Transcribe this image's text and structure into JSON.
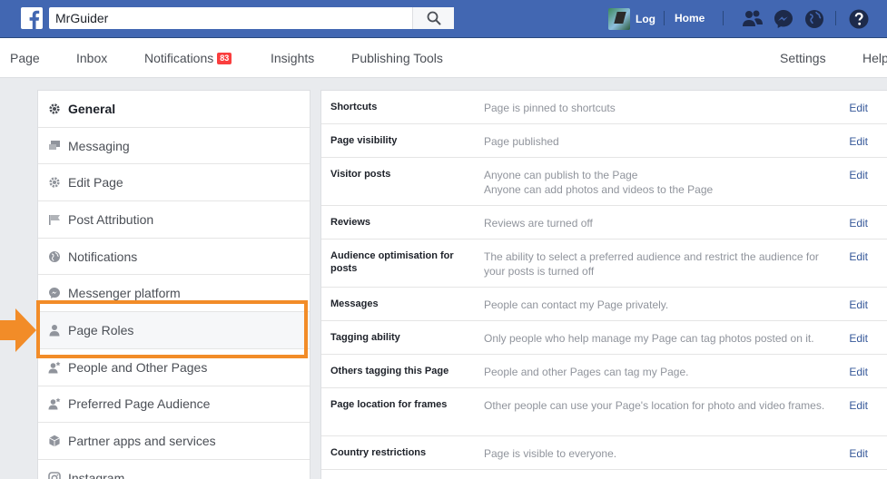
{
  "topbar": {
    "search_value": "MrGuider",
    "user_name": "Log",
    "home_label": "Home"
  },
  "tabs": {
    "page": "Page",
    "inbox": "Inbox",
    "notifications": "Notifications",
    "notifications_count": "83",
    "insights": "Insights",
    "publishing_tools": "Publishing Tools",
    "settings": "Settings",
    "help": "Help"
  },
  "sidebar": {
    "items": [
      {
        "label": "General",
        "icon": "gear-icon"
      },
      {
        "label": "Messaging",
        "icon": "chat-icon"
      },
      {
        "label": "Edit Page",
        "icon": "gear-icon"
      },
      {
        "label": "Post Attribution",
        "icon": "flag-icon"
      },
      {
        "label": "Notifications",
        "icon": "globe-icon"
      },
      {
        "label": "Messenger platform",
        "icon": "messenger-icon"
      },
      {
        "label": "Page Roles",
        "icon": "person-icon"
      },
      {
        "label": "People and Other Pages",
        "icon": "person-star-icon"
      },
      {
        "label": "Preferred Page Audience",
        "icon": "person-star-icon"
      },
      {
        "label": "Partner apps and services",
        "icon": "cube-icon"
      },
      {
        "label": "Instagram",
        "icon": "instagram-icon"
      }
    ]
  },
  "settings": {
    "edit_label": "Edit",
    "rows": [
      {
        "label": "Shortcuts",
        "value": "Page is pinned to shortcuts"
      },
      {
        "label": "Page visibility",
        "value": "Page published"
      },
      {
        "label": "Visitor posts",
        "value": "Anyone can publish to the Page",
        "value2": "Anyone can add photos and videos to the Page"
      },
      {
        "label": "Reviews",
        "value": "Reviews are turned off"
      },
      {
        "label": "Audience optimisation for posts",
        "value": "The ability to select a preferred audience and restrict the audience for your posts is turned off"
      },
      {
        "label": "Messages",
        "value": "People can contact my Page privately."
      },
      {
        "label": "Tagging ability",
        "value": "Only people who help manage my Page can tag photos posted on it."
      },
      {
        "label": "Others tagging this Page",
        "value": "People and other Pages can tag my Page."
      },
      {
        "label": "Page location for frames",
        "value": "Other people can use your Page's location for photo and video frames."
      },
      {
        "label": "Country restrictions",
        "value": "Page is visible to everyone."
      }
    ]
  },
  "colors": {
    "brand_blue": "#4267b2",
    "link_blue": "#365899",
    "badge_red": "#fa3e3e",
    "highlight_orange": "#f28c28"
  }
}
